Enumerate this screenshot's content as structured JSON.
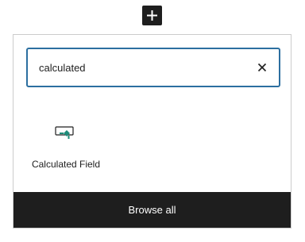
{
  "toolbar": {
    "add_block_icon": "plus-icon"
  },
  "search": {
    "value": "calculated",
    "placeholder": "Search",
    "clear_icon": "close-icon"
  },
  "results": [
    {
      "label": "Calculated Field",
      "icon": "calculated-field-icon",
      "accent_color": "#1f8c7a"
    }
  ],
  "footer": {
    "browse_all_label": "Browse all"
  }
}
